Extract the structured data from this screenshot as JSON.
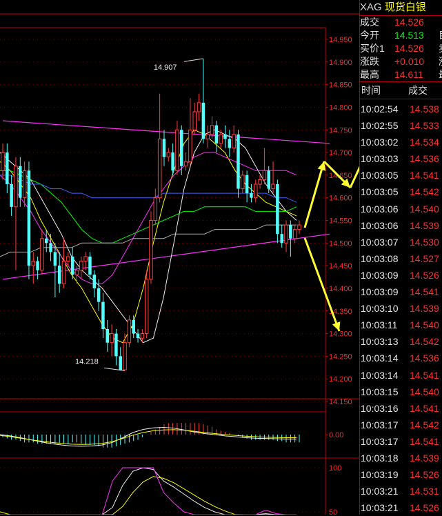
{
  "header": {
    "symbol": "XAG",
    "name": "现货白银",
    "rows": [
      {
        "label": "成交",
        "value": "14.526",
        "color": "#ff3030",
        "edge": ""
      },
      {
        "label": "今开",
        "value": "14.513",
        "color": "#00ff00",
        "edge": "目"
      },
      {
        "label": "买价1",
        "value": "14.526",
        "color": "#ff3030",
        "edge": "卖"
      },
      {
        "label": "涨跌",
        "value": "+0.010",
        "color": "#ff3030",
        "edge": "涨"
      },
      {
        "label": "最高",
        "value": "14.611",
        "color": "#ff3030",
        "edge": "最"
      }
    ]
  },
  "ticks_header": {
    "time": "时间",
    "price": "成交"
  },
  "ticks": [
    {
      "time": "10:02:54",
      "price": "14.538"
    },
    {
      "time": "10:02:55",
      "price": "14.533"
    },
    {
      "time": "10:03:02",
      "price": "14.534"
    },
    {
      "time": "10:03:03",
      "price": "14.536"
    },
    {
      "time": "10:03:05",
      "price": "14.541"
    },
    {
      "time": "10:03:05",
      "price": "14.542"
    },
    {
      "time": "10:03:06",
      "price": "14.540"
    },
    {
      "time": "10:03:06",
      "price": "14.539"
    },
    {
      "time": "10:03:07",
      "price": "14.530"
    },
    {
      "time": "10:03:08",
      "price": "14.527"
    },
    {
      "time": "10:03:09",
      "price": "14.526"
    },
    {
      "time": "10:03:09",
      "price": "14.541"
    },
    {
      "time": "10:03:10",
      "price": "14.539"
    },
    {
      "time": "10:03:11",
      "price": "14.540"
    },
    {
      "time": "10:03:13",
      "price": "14.542"
    },
    {
      "time": "10:03:14",
      "price": "14.536"
    },
    {
      "time": "10:03:14",
      "price": "14.541"
    },
    {
      "time": "10:03:15",
      "price": "14.540"
    },
    {
      "time": "10:03:16",
      "price": "14.541"
    },
    {
      "time": "10:03:17",
      "price": "14.542"
    },
    {
      "time": "10:03:17",
      "price": "14.541"
    },
    {
      "time": "10:03:18",
      "price": "14.539"
    },
    {
      "time": "10:03:19",
      "price": "14.526"
    },
    {
      "time": "10:03:21",
      "price": "14.531"
    },
    {
      "time": "10:03:21",
      "price": "14.526"
    }
  ],
  "colors": {
    "up": "#ff4040",
    "down": "#54ffff",
    "axis": "#c00000",
    "ma5": "#f0f0f0",
    "ma10": "#ffff00",
    "ma20": "#ff30ff",
    "ma30": "#00ff00",
    "ma60": "#4060ff",
    "ma120": "#b0b0b0",
    "annotation": "#ffff33"
  },
  "chart_data": [
    {
      "type": "candlestick",
      "ylim": [
        14.15,
        14.95
      ],
      "yticks": [
        "14.950",
        "14.900",
        "14.850",
        "14.800",
        "14.750",
        "14.700",
        "14.650",
        "14.600",
        "14.550",
        "14.500",
        "14.450",
        "14.400",
        "14.350",
        "14.300",
        "14.250",
        "14.200",
        "14.150"
      ],
      "high_label": "14.907",
      "high_value": 14.907,
      "high_index": 46,
      "low_label": "14.218",
      "low_value": 14.218,
      "low_index": 28,
      "candles": [
        [
          14.66,
          14.7,
          14.64,
          14.72
        ],
        [
          14.7,
          14.63,
          14.61,
          14.72
        ],
        [
          14.63,
          14.58,
          14.56,
          14.65
        ],
        [
          14.58,
          14.67,
          14.44,
          14.69
        ],
        [
          14.67,
          14.6,
          14.58,
          14.69
        ],
        [
          14.6,
          14.66,
          14.58,
          14.68
        ],
        [
          14.66,
          14.45,
          14.42,
          14.68
        ],
        [
          14.45,
          14.46,
          14.41,
          14.48
        ],
        [
          14.46,
          14.44,
          14.42,
          14.47
        ],
        [
          14.44,
          14.51,
          14.43,
          14.53
        ],
        [
          14.51,
          14.5,
          14.48,
          14.53
        ],
        [
          14.5,
          14.48,
          14.46,
          14.52
        ],
        [
          14.48,
          14.45,
          14.38,
          14.5
        ],
        [
          14.45,
          14.41,
          14.39,
          14.48
        ],
        [
          14.41,
          14.46,
          14.4,
          14.51
        ],
        [
          14.46,
          14.47,
          14.45,
          14.48
        ],
        [
          14.47,
          14.43,
          14.42,
          14.49
        ],
        [
          14.43,
          14.44,
          14.41,
          14.45
        ],
        [
          14.44,
          14.46,
          14.42,
          14.47
        ],
        [
          14.46,
          14.47,
          14.44,
          14.48
        ],
        [
          14.47,
          14.43,
          14.42,
          14.48
        ],
        [
          14.43,
          14.4,
          14.38,
          14.44
        ],
        [
          14.4,
          14.37,
          14.35,
          14.42
        ],
        [
          14.37,
          14.31,
          14.29,
          14.39
        ],
        [
          14.31,
          14.28,
          14.26,
          14.33
        ],
        [
          14.28,
          14.3,
          14.25,
          14.32
        ],
        [
          14.3,
          14.25,
          14.23,
          14.31
        ],
        [
          14.25,
          14.22,
          14.218,
          14.27
        ],
        [
          14.22,
          14.28,
          14.22,
          14.3
        ],
        [
          14.28,
          14.33,
          14.27,
          14.34
        ],
        [
          14.33,
          14.3,
          14.29,
          14.34
        ],
        [
          14.3,
          14.29,
          14.28,
          14.31
        ],
        [
          14.29,
          14.3,
          14.28,
          14.31
        ],
        [
          14.3,
          14.42,
          14.29,
          14.44
        ],
        [
          14.42,
          14.55,
          14.41,
          14.57
        ],
        [
          14.55,
          14.6,
          14.54,
          14.62
        ],
        [
          14.6,
          14.73,
          14.59,
          14.83
        ],
        [
          14.73,
          14.69,
          14.67,
          14.75
        ],
        [
          14.69,
          14.7,
          14.68,
          14.71
        ],
        [
          14.7,
          14.66,
          14.65,
          14.72
        ],
        [
          14.66,
          14.75,
          14.65,
          14.77
        ],
        [
          14.75,
          14.67,
          14.65,
          14.76
        ],
        [
          14.67,
          14.68,
          14.66,
          14.7
        ],
        [
          14.68,
          14.75,
          14.67,
          14.82
        ],
        [
          14.75,
          14.79,
          14.74,
          14.81
        ],
        [
          14.79,
          14.81,
          14.77,
          14.83
        ],
        [
          14.81,
          14.73,
          14.72,
          14.907
        ],
        [
          14.73,
          14.74,
          14.71,
          14.76
        ],
        [
          14.74,
          14.76,
          14.73,
          14.78
        ],
        [
          14.76,
          14.72,
          14.7,
          14.77
        ],
        [
          14.72,
          14.74,
          14.71,
          14.75
        ],
        [
          14.74,
          14.73,
          14.71,
          14.76
        ],
        [
          14.73,
          14.71,
          14.69,
          14.75
        ],
        [
          14.71,
          14.74,
          14.7,
          14.76
        ],
        [
          14.74,
          14.62,
          14.6,
          14.75
        ],
        [
          14.62,
          14.65,
          14.61,
          14.66
        ],
        [
          14.65,
          14.61,
          14.59,
          14.66
        ],
        [
          14.61,
          14.6,
          14.59,
          14.63
        ],
        [
          14.6,
          14.63,
          14.59,
          14.64
        ],
        [
          14.63,
          14.64,
          14.62,
          14.65
        ],
        [
          14.64,
          14.66,
          14.63,
          14.71
        ],
        [
          14.66,
          14.62,
          14.61,
          14.67
        ],
        [
          14.62,
          14.63,
          14.61,
          14.68
        ],
        [
          14.63,
          14.52,
          14.5,
          14.64
        ],
        [
          14.52,
          14.5,
          14.49,
          14.54
        ],
        [
          14.5,
          14.54,
          14.48,
          14.55
        ],
        [
          14.54,
          14.51,
          14.47,
          14.55
        ],
        [
          14.51,
          14.53,
          14.5,
          14.54
        ],
        [
          14.53,
          14.54,
          14.52,
          14.55
        ]
      ],
      "ma_lines": {
        "ma5": [
          14.7,
          14.68,
          14.66,
          14.64,
          14.6,
          14.56,
          14.52,
          14.47,
          14.44,
          14.42,
          14.4,
          14.37,
          14.34,
          14.31,
          14.28,
          14.29,
          14.38,
          14.5,
          14.62,
          14.7,
          14.74,
          14.75,
          14.74,
          14.73,
          14.71,
          14.67,
          14.63,
          14.6,
          14.57,
          14.55
        ],
        "ma10": [
          14.68,
          14.66,
          14.63,
          14.6,
          14.55,
          14.51,
          14.47,
          14.43,
          14.4,
          14.36,
          14.32,
          14.29,
          14.28,
          14.32,
          14.4,
          14.5,
          14.59,
          14.66,
          14.72,
          14.75,
          14.74,
          14.72,
          14.7,
          14.66,
          14.63,
          14.61,
          14.59,
          14.58,
          14.57,
          14.56
        ],
        "ma20": [
          14.65,
          14.63,
          14.6,
          14.57,
          14.53,
          14.5,
          14.47,
          14.44,
          14.42,
          14.41,
          14.41,
          14.43,
          14.47,
          14.51,
          14.55,
          14.59,
          14.62,
          14.65,
          14.67,
          14.69,
          14.7,
          14.7,
          14.69,
          14.68,
          14.67,
          14.66,
          14.66,
          14.66,
          14.66,
          14.65
        ],
        "ma30": [
          14.66,
          14.66,
          14.65,
          14.64,
          14.63,
          14.61,
          14.59,
          14.56,
          14.53,
          14.51,
          14.5,
          14.5,
          14.51,
          14.52,
          14.53,
          14.54,
          14.55,
          14.56,
          14.57,
          14.57,
          14.58,
          14.58,
          14.58,
          14.58,
          14.58,
          14.57,
          14.57,
          14.57,
          14.57,
          14.58
        ],
        "ma60": [
          14.65,
          14.65,
          14.64,
          14.63,
          14.63,
          14.62,
          14.62,
          14.61,
          14.61,
          14.6,
          14.6,
          14.6,
          14.6,
          14.6,
          14.6,
          14.6,
          14.61,
          14.61,
          14.61,
          14.61,
          14.61,
          14.61,
          14.61,
          14.61,
          14.61,
          14.61,
          14.61,
          14.6,
          14.6,
          14.59
        ],
        "ma120": [
          14.47,
          14.48,
          14.48,
          14.48,
          14.49,
          14.49,
          14.49,
          14.49,
          14.5,
          14.5,
          14.5,
          14.5,
          14.5,
          14.51,
          14.51,
          14.51,
          14.51,
          14.52,
          14.52,
          14.52,
          14.52,
          14.53,
          14.53,
          14.53,
          14.53,
          14.53,
          14.54,
          14.54,
          14.54,
          14.54
        ]
      },
      "trend_lines": [
        {
          "from": [
            0,
            14.77
          ],
          "to": [
            75,
            14.72
          ],
          "color": "#ff30ff"
        },
        {
          "from": [
            0,
            14.42
          ],
          "to": [
            75,
            14.52
          ],
          "color": "#ff30ff"
        }
      ]
    },
    {
      "type": "macd",
      "ylim": [
        -0.08,
        0.08
      ],
      "yticks": [
        "0.00"
      ],
      "histogram": [
        -0.01,
        -0.015,
        -0.02,
        -0.02,
        -0.025,
        -0.03,
        -0.03,
        -0.03,
        -0.035,
        -0.035,
        -0.035,
        -0.035,
        -0.035,
        -0.035,
        -0.035,
        -0.035,
        -0.03,
        -0.03,
        -0.035,
        -0.04,
        -0.04,
        -0.04,
        -0.045,
        -0.05,
        -0.05,
        -0.05,
        -0.045,
        -0.04,
        -0.035,
        -0.03,
        -0.025,
        -0.02,
        -0.01,
        0.0,
        0.01,
        0.02,
        0.03,
        0.04,
        0.045,
        0.045,
        0.045,
        0.045,
        0.045,
        0.045,
        0.045,
        0.045,
        0.04,
        0.035,
        0.03,
        0.02,
        0.015,
        0.01,
        0.005,
        0.0,
        -0.005,
        -0.01,
        -0.015,
        -0.02,
        -0.02,
        -0.02,
        -0.02,
        -0.02,
        -0.02,
        -0.025,
        -0.025,
        -0.03,
        -0.03,
        -0.03,
        -0.03
      ],
      "dif": [
        0.0,
        -0.005,
        -0.012,
        -0.02,
        -0.028,
        -0.035,
        -0.04,
        -0.044,
        -0.045,
        -0.044,
        -0.04,
        -0.03,
        -0.012,
        0.008,
        0.02,
        0.026,
        0.028,
        0.025,
        0.018,
        0.01,
        0.004,
        0.0,
        -0.005,
        -0.008,
        -0.012,
        -0.014,
        -0.015,
        -0.016,
        -0.017,
        -0.017
      ],
      "dea": [
        -0.003,
        -0.008,
        -0.014,
        -0.02,
        -0.025,
        -0.03,
        -0.034,
        -0.037,
        -0.038,
        -0.037,
        -0.034,
        -0.027,
        -0.015,
        -0.002,
        0.008,
        0.015,
        0.018,
        0.019,
        0.017,
        0.013,
        0.008,
        0.004,
        0.0,
        -0.003,
        -0.006,
        -0.008,
        -0.01,
        -0.011,
        -0.012,
        -0.012
      ]
    },
    {
      "type": "kdj",
      "ylim": [
        20,
        105
      ],
      "yticks": [
        "100",
        "50"
      ],
      "k": [
        45,
        42,
        30,
        28,
        33,
        31,
        29,
        25,
        24,
        27,
        35,
        55,
        80,
        96,
        100,
        98,
        85,
        78,
        70,
        62,
        55,
        50,
        46,
        42,
        40,
        44,
        48,
        46,
        44,
        43
      ],
      "d": [
        50,
        46,
        38,
        33,
        32,
        31,
        30,
        28,
        27,
        28,
        31,
        40,
        56,
        72,
        84,
        90,
        88,
        83,
        76,
        69,
        62,
        56,
        51,
        47,
        44,
        44,
        45,
        45,
        44,
        44
      ],
      "j": [
        40,
        34,
        18,
        16,
        30,
        30,
        27,
        20,
        18,
        25,
        42,
        85,
        100,
        100,
        100,
        100,
        72,
        60,
        50,
        40,
        36,
        34,
        32,
        30,
        28,
        40,
        52,
        48,
        42,
        40
      ]
    }
  ]
}
